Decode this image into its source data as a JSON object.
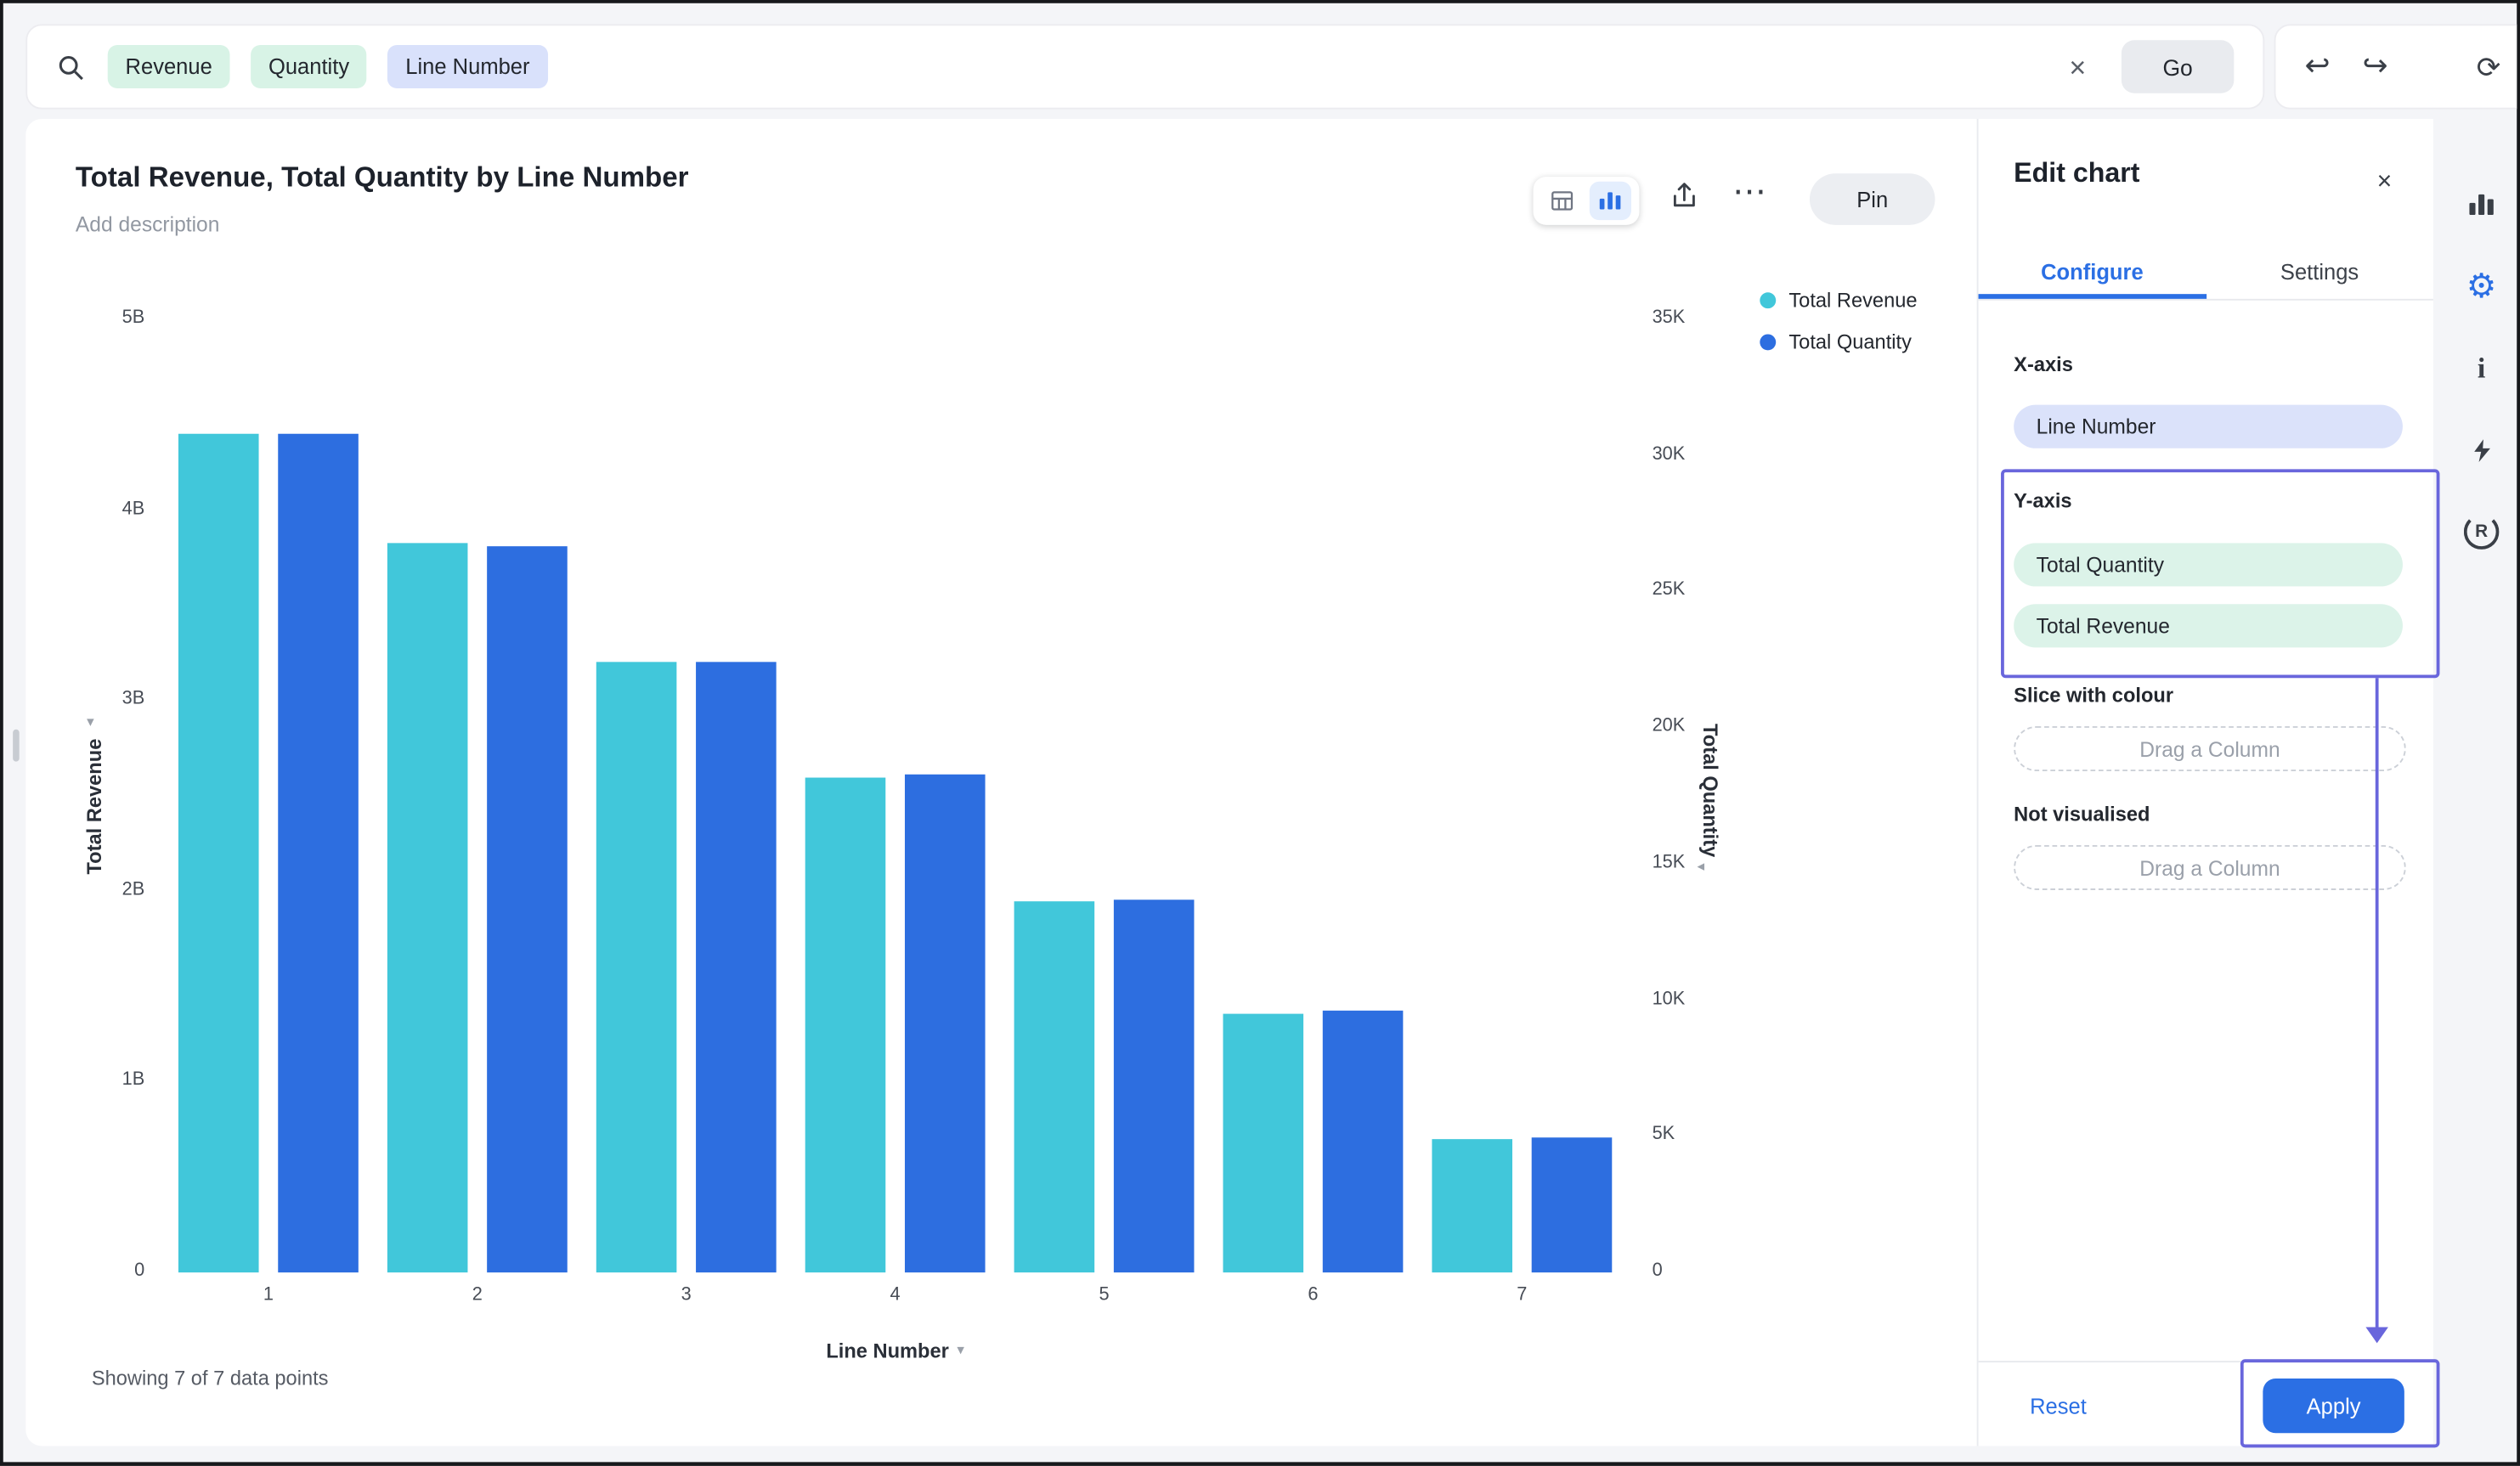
{
  "colors": {
    "accent_blue": "#2B6FE4",
    "series_cyan": "#41C7DA",
    "series_blue": "#2D6EE0",
    "token_green": "#D8F3E6",
    "token_lavender": "#D9E1FB",
    "pill_mint": "#DCF3E9",
    "pill_lavender": "#DBE2FA",
    "highlight_purple": "#6966DC",
    "btn_gray": "#E9EBEF"
  },
  "icons": {
    "close": "×",
    "undo": "↩",
    "redo": "↪",
    "refresh": "⟳",
    "more": "⋯",
    "gear": "⚙",
    "info": "i",
    "r_letter": "R",
    "sort_caret_down": "▾",
    "sort_caret_left": "◂"
  },
  "search": {
    "tokens": [
      {
        "label": "Revenue",
        "bg": "token_green"
      },
      {
        "label": "Quantity",
        "bg": "token_green"
      },
      {
        "label": "Line Number",
        "bg": "token_lavender"
      }
    ],
    "go_label": "Go"
  },
  "chart_header": {
    "description_placeholder": "Add description",
    "pin_label": "Pin"
  },
  "chart_data": {
    "type": "bar",
    "title": "Total Revenue, Total Quantity by Line Number",
    "categories": [
      "1",
      "2",
      "3",
      "4",
      "5",
      "6",
      "7"
    ],
    "series": [
      {
        "name": "Total Revenue",
        "axis": "left",
        "unit": "B",
        "color": "#41C7DA",
        "values": [
          4.4,
          3.83,
          3.2,
          2.6,
          1.95,
          1.36,
          0.7
        ]
      },
      {
        "name": "Total Quantity",
        "axis": "right",
        "unit": "K",
        "color": "#2D6EE0",
        "values": [
          30.8,
          26.7,
          22.4,
          18.3,
          13.7,
          9.6,
          4.95
        ]
      }
    ],
    "axes": {
      "left": {
        "label": "Total Revenue",
        "max": 5,
        "ticks": [
          "5B",
          "4B",
          "3B",
          "2B",
          "1B",
          "0"
        ]
      },
      "right": {
        "label": "Total Quantity",
        "max": 35,
        "ticks": [
          "35K",
          "30K",
          "25K",
          "20K",
          "15K",
          "10K",
          "5K",
          "0"
        ]
      },
      "x": {
        "label": "Line Number"
      }
    },
    "legend_position": "top-right",
    "grid": false
  },
  "footer": {
    "status": "Showing 7 of 7 data points"
  },
  "edit_panel": {
    "title": "Edit chart",
    "tabs": [
      {
        "label": "Configure",
        "active": true
      },
      {
        "label": "Settings",
        "active": false
      }
    ],
    "x_axis": {
      "label": "X-axis",
      "value": "Line Number"
    },
    "y_axis": {
      "label": "Y-axis",
      "values": [
        "Total Quantity",
        "Total Revenue"
      ]
    },
    "slice": {
      "label": "Slice with colour",
      "placeholder": "Drag a Column"
    },
    "not_visualised": {
      "label": "Not visualised",
      "placeholder": "Drag a Column"
    },
    "reset_label": "Reset",
    "apply_label": "Apply"
  }
}
